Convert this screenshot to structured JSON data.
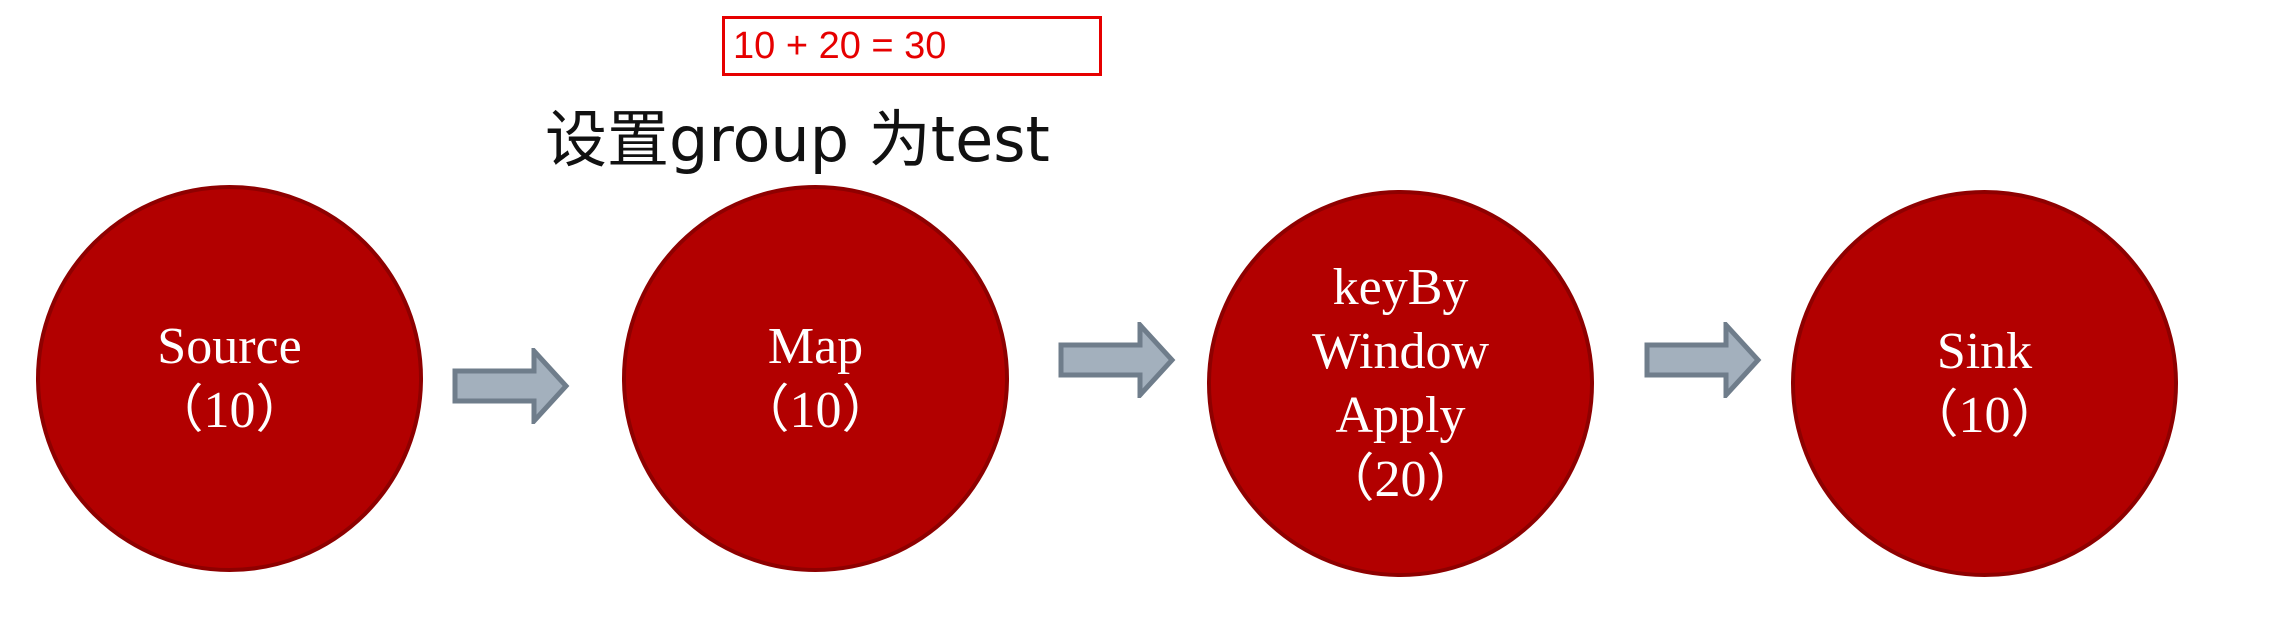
{
  "formula": {
    "text": "10 + 20 = 30"
  },
  "group_label": {
    "text": "设置group 为test"
  },
  "nodes": [
    {
      "name": "Source",
      "lines": [
        "Source"
      ],
      "parallelism": "（10）"
    },
    {
      "name": "Map",
      "lines": [
        "Map"
      ],
      "parallelism": "（10）"
    },
    {
      "name": "keyBy Window Apply",
      "lines": [
        "keyBy",
        "Window",
        "Apply"
      ],
      "parallelism": "（20）"
    },
    {
      "name": "Sink",
      "lines": [
        "Sink"
      ],
      "parallelism": "（10）"
    }
  ],
  "colors": {
    "node_fill": "#b20000",
    "node_border": "#8e0000",
    "arrow_fill": "#a3b0bd",
    "arrow_stroke": "#6f7d8b",
    "formula": "#e60000"
  },
  "arrows": [
    {
      "from": "Source",
      "to": "Map"
    },
    {
      "from": "Map",
      "to": "keyBy Window Apply"
    },
    {
      "from": "keyBy Window Apply",
      "to": "Sink"
    }
  ]
}
